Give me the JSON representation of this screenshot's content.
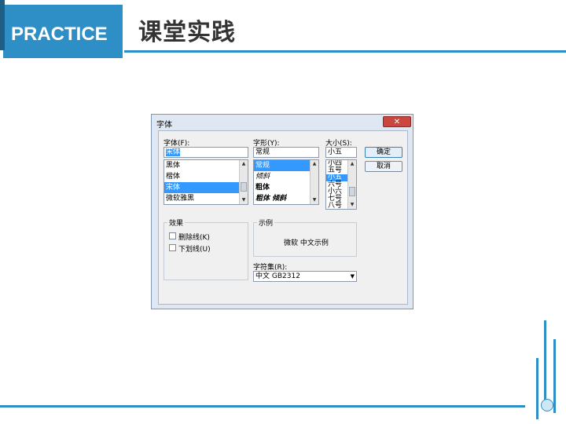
{
  "header": {
    "badge": "PRACTICE",
    "title": "课堂实践"
  },
  "dialog": {
    "title": "字体",
    "close_symbol": "✕",
    "font": {
      "label": "字体(F):",
      "value": "宋体",
      "items": [
        "黑体",
        "楷体",
        "宋体",
        "微软雅黑"
      ],
      "selected_index": 2
    },
    "style": {
      "label": "字形(Y):",
      "value": "常规",
      "items": [
        "常规",
        "倾斜",
        "粗体",
        "粗体 倾斜"
      ],
      "selected_index": 0
    },
    "size": {
      "label": "大小(S):",
      "value": "小五",
      "items": [
        "小四",
        "五号",
        "小五",
        "六号",
        "小六",
        "七号",
        "八号"
      ],
      "selected_index": 2
    },
    "ok_button": "确定",
    "cancel_button": "取消",
    "effects": {
      "title": "效果",
      "strikeout": "删除线(K)",
      "underline": "下划线(U)"
    },
    "sample": {
      "title": "示例",
      "text": "微软 中文示例"
    },
    "charset": {
      "label": "字符集(R):",
      "value": "中文 GB2312"
    }
  },
  "colors": {
    "accent": "#2e8fc6",
    "selection": "#3399ff",
    "close": "#c9473e"
  }
}
